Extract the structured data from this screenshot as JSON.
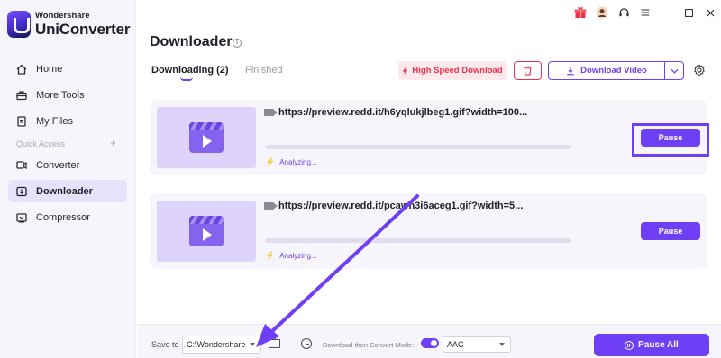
{
  "app": {
    "brand_top": "Wondershare",
    "brand_main": "UniConverter"
  },
  "sidebar": {
    "items": [
      {
        "label": "Home",
        "icon": "home-icon"
      },
      {
        "label": "More Tools",
        "icon": "toolbox-icon"
      },
      {
        "label": "My Files",
        "icon": "files-icon"
      },
      {
        "label": "Converter",
        "icon": "converter-icon"
      },
      {
        "label": "Downloader",
        "icon": "downloader-icon",
        "active": true
      },
      {
        "label": "Compressor",
        "icon": "compressor-icon"
      }
    ],
    "quick_access_label": "Quick Access"
  },
  "titlebar": {
    "icons": [
      "gift-icon",
      "avatar-icon",
      "headset-icon",
      "menu-icon",
      "minimize-icon",
      "maximize-icon",
      "close-icon"
    ]
  },
  "header": {
    "title": "Downloader"
  },
  "tabs": [
    {
      "label": "Downloading",
      "count": "(2)",
      "active": true
    },
    {
      "label": "Finished",
      "active": false
    }
  ],
  "toolbar": {
    "high_speed_label": "High Speed Download",
    "download_video_label": "Download Video"
  },
  "downloads": [
    {
      "url": "https://preview.redd.it/h6yqlukjlbeg1.gif?width=100...",
      "status": "Analyzing...",
      "button": "Pause",
      "progress": 0
    },
    {
      "url": "https://preview.redd.it/pcawn3i6aceg1.gif?width=5...",
      "status": "Analyzing...",
      "button": "Pause",
      "progress": 0
    }
  ],
  "footer": {
    "save_to_label": "Save to",
    "save_path": "C:\\Wondershare",
    "convert_mode_label": "Download then Convert Mode:",
    "convert_mode_on": true,
    "format": "AAC",
    "pause_all_label": "Pause All"
  },
  "colors": {
    "accent": "#6f3ff5",
    "danger": "#f0304f",
    "sidebar_bg": "#f6f5fb",
    "active_nav": "#e7e1f9"
  }
}
